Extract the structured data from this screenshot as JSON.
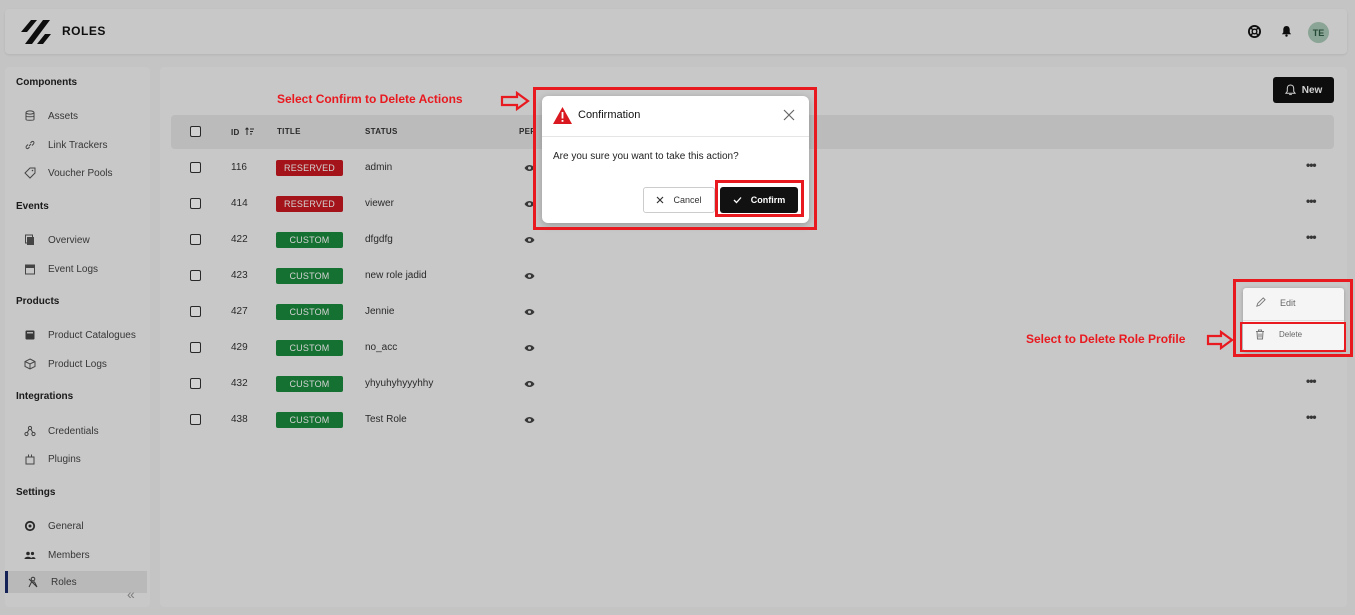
{
  "header": {
    "title": "ROLES",
    "avatar_initials": "TE"
  },
  "sidebar": {
    "sections": [
      {
        "label": "Components",
        "items": [
          {
            "label": "Assets",
            "icon": "database-icon"
          },
          {
            "label": "Link Trackers",
            "icon": "link-icon"
          },
          {
            "label": "Voucher Pools",
            "icon": "tag-icon"
          }
        ]
      },
      {
        "label": "Events",
        "items": [
          {
            "label": "Overview",
            "icon": "copy-icon"
          },
          {
            "label": "Event Logs",
            "icon": "calendar-icon"
          }
        ]
      },
      {
        "label": "Products",
        "items": [
          {
            "label": "Product Catalogues",
            "icon": "catalogue-icon"
          },
          {
            "label": "Product Logs",
            "icon": "box-icon"
          }
        ]
      },
      {
        "label": "Integrations",
        "items": [
          {
            "label": "Credentials",
            "icon": "credentials-icon"
          },
          {
            "label": "Plugins",
            "icon": "plugin-icon"
          }
        ]
      },
      {
        "label": "Settings",
        "items": [
          {
            "label": "General",
            "icon": "gear-icon"
          },
          {
            "label": "Members",
            "icon": "users-icon"
          },
          {
            "label": "Roles",
            "icon": "roles-icon",
            "active": true
          }
        ]
      }
    ],
    "collapse_glyph": "«"
  },
  "toolbar": {
    "new_label": "New"
  },
  "table": {
    "columns": {
      "id": "ID",
      "title": "TITLE",
      "status": "STATUS",
      "permissions": "PER"
    },
    "rows": [
      {
        "id": "116",
        "title": "RESERVED",
        "status": "admin",
        "kind": "reserved"
      },
      {
        "id": "414",
        "title": "RESERVED",
        "status": "viewer",
        "kind": "reserved"
      },
      {
        "id": "422",
        "title": "CUSTOM",
        "status": "dfgdfg",
        "kind": "custom"
      },
      {
        "id": "423",
        "title": "CUSTOM",
        "status": "new role jadid",
        "kind": "custom"
      },
      {
        "id": "427",
        "title": "CUSTOM",
        "status": "Jennie",
        "kind": "custom"
      },
      {
        "id": "429",
        "title": "CUSTOM",
        "status": "no_acc",
        "kind": "custom"
      },
      {
        "id": "432",
        "title": "CUSTOM",
        "status": "yhyuhyhyyyhhy",
        "kind": "custom"
      },
      {
        "id": "438",
        "title": "CUSTOM",
        "status": "Test Role",
        "kind": "custom"
      }
    ],
    "row_action_glyph": "•••"
  },
  "context_menu": {
    "edit_label": "Edit",
    "delete_label": "Delete"
  },
  "modal": {
    "title": "Confirmation",
    "message": "Are you sure you want to take this action?",
    "cancel_label": "Cancel",
    "confirm_label": "Confirm"
  },
  "annotations": {
    "confirm_note": "Select Confirm to Delete Actions",
    "delete_note": "Select to Delete Role Profile"
  },
  "colors": {
    "reserved": "#c9181f",
    "custom": "#1a8a3c",
    "highlight": "#e8191f",
    "active_indicator": "#1a2a6c"
  }
}
